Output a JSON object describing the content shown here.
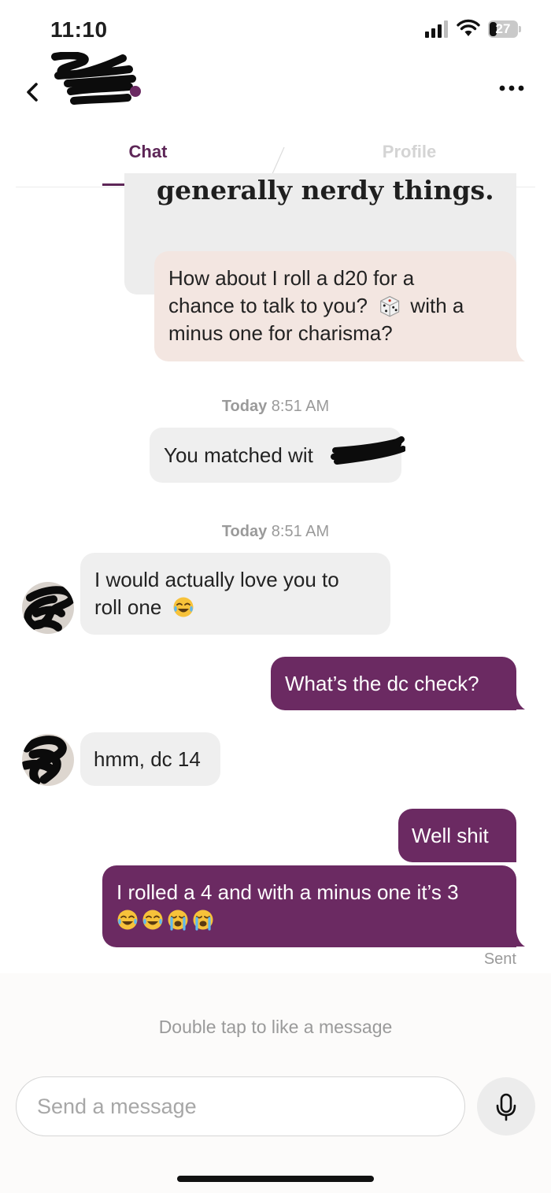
{
  "status_bar": {
    "time": "11:10",
    "battery_level": "27",
    "battery_fraction": 0.27
  },
  "tabs": {
    "chat": "Chat",
    "profile": "Profile"
  },
  "prompt": {
    "answer_fragment": "generally nerdy things."
  },
  "comment": {
    "line1": "How about I roll a d20 for a",
    "line2_before": "chance to talk to you?",
    "line2_after": "with a",
    "line3": "minus one for charisma?",
    "emoji": "game-die-icon"
  },
  "timestamps": [
    {
      "day": "Today",
      "time": "8:51 AM"
    },
    {
      "day": "Today",
      "time": "8:51 AM"
    }
  ],
  "match_notice": {
    "text": "You matched wit"
  },
  "messages": [
    {
      "sender": "them",
      "lines": [
        "I would actually love you to",
        "roll one"
      ],
      "emojis": [
        "tears-of-joy-emoji"
      ]
    },
    {
      "sender": "me",
      "lines": [
        "What’s the dc check?"
      ]
    },
    {
      "sender": "them",
      "lines": [
        "hmm, dc 14"
      ]
    },
    {
      "sender": "me",
      "lines": [
        "Well shit"
      ]
    },
    {
      "sender": "me",
      "lines": [
        "I rolled a 4 and with a minus one it’s 3"
      ],
      "emojis": [
        "tears-of-joy-emoji",
        "tears-of-joy-emoji",
        "loudly-crying-emoji",
        "loudly-crying-emoji"
      ]
    }
  ],
  "sent_label": "Sent",
  "hint": "Double tap to like a message",
  "input": {
    "placeholder": "Send a message",
    "value": ""
  },
  "colors": {
    "brand_purple": "#6b2a62",
    "tab_active": "#5d2657",
    "peach": "#f3e6e1",
    "gray_bubble": "#efefef"
  },
  "icons": {
    "back": "chevron-left-icon",
    "more": "more-dots-icon",
    "mic": "microphone-icon"
  }
}
